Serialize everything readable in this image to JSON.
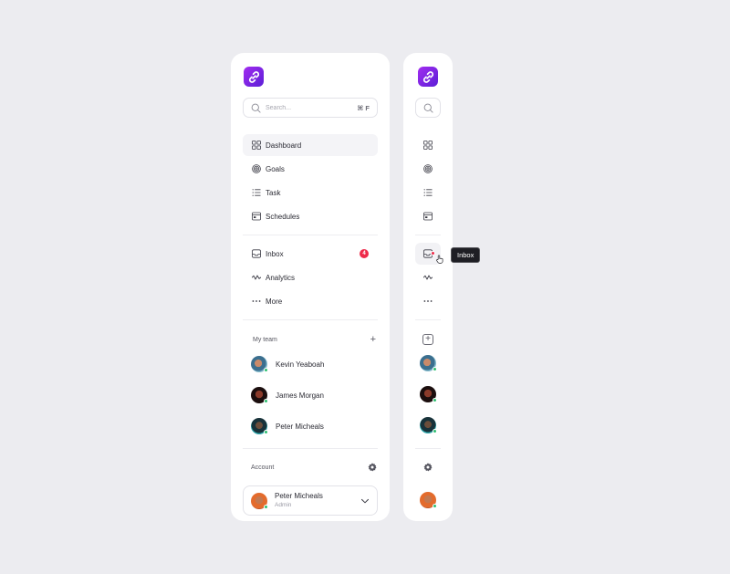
{
  "search": {
    "placeholder": "Search...",
    "shortcut": "⌘ F"
  },
  "nav_main": [
    {
      "label": "Dashboard",
      "icon": "grid-icon",
      "active": true
    },
    {
      "label": "Goals",
      "icon": "target-icon"
    },
    {
      "label": "Task",
      "icon": "list-icon"
    },
    {
      "label": "Schedules",
      "icon": "calendar-card-icon"
    }
  ],
  "nav_secondary": [
    {
      "label": "Inbox",
      "icon": "inbox-icon",
      "badge": "4"
    },
    {
      "label": "Analytics",
      "icon": "pulse-icon"
    },
    {
      "label": "More",
      "icon": "more-dots-icon"
    }
  ],
  "team": {
    "title": "My team",
    "members": [
      {
        "name": "Kevin Yeaboah",
        "status": "online"
      },
      {
        "name": "James Morgan",
        "status": "online"
      },
      {
        "name": "Peter Micheals",
        "status": "online"
      }
    ]
  },
  "account": {
    "title": "Account",
    "name": "Peter Micheals",
    "role": "Admin"
  },
  "tooltip": {
    "text": "Inbox"
  },
  "colors": {
    "background": "#ECECF0",
    "panel": "#FFFFFF",
    "brand_start": "#A22CF0",
    "brand_end": "#5B1FD6",
    "badge": "#EE2A4A",
    "online": "#2FBF71",
    "active_bg": "#F4F4F7"
  }
}
